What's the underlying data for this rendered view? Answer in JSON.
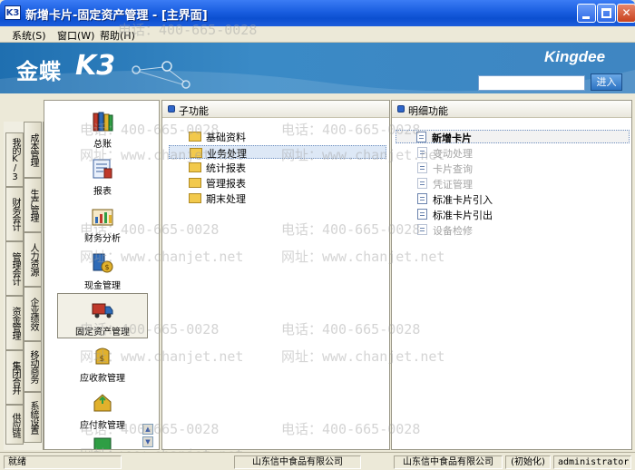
{
  "window": {
    "logo_text": "K3",
    "title": "新增卡片-固定资产管理 - [主界面]"
  },
  "menu": [
    {
      "label": "系统(S)"
    },
    {
      "label": "窗口(W)"
    },
    {
      "label": "帮助(H)"
    }
  ],
  "banner": {
    "brand_cn": "金蝶",
    "brand_k3": "K3",
    "brand_right": "Kingdee",
    "go_label": "进入",
    "search_value": ""
  },
  "left_tabs_col1": [
    {
      "label": "我的K/3"
    },
    {
      "label": "财务会计"
    },
    {
      "label": "管理会计"
    },
    {
      "label": "资金管理"
    },
    {
      "label": "集团合并"
    },
    {
      "label": "供应链"
    }
  ],
  "left_tabs_col2": [
    {
      "label": "成本管理"
    },
    {
      "label": "生产管理"
    },
    {
      "label": "人力资源"
    },
    {
      "label": "企业绩效"
    },
    {
      "label": "移动商务"
    },
    {
      "label": "系统设置"
    }
  ],
  "modules": [
    {
      "label": "总账",
      "icon": "books-icon"
    },
    {
      "label": "报表",
      "icon": "report-icon"
    },
    {
      "label": "财务分析",
      "icon": "analysis-icon"
    },
    {
      "label": "现金管理",
      "icon": "cash-icon"
    },
    {
      "label": "固定资产管理",
      "icon": "truck-icon"
    },
    {
      "label": "应收款管理",
      "icon": "receivable-icon"
    },
    {
      "label": "应付款管理",
      "icon": "payable-icon"
    }
  ],
  "sub_panel": {
    "title": "子功能",
    "items": [
      {
        "label": "基础资料"
      },
      {
        "label": "业务处理"
      },
      {
        "label": "统计报表"
      },
      {
        "label": "管理报表"
      },
      {
        "label": "期末处理"
      }
    ]
  },
  "detail_panel": {
    "title": "明细功能",
    "items": [
      {
        "label": "新增卡片"
      },
      {
        "label": "变动处理"
      },
      {
        "label": "卡片查询"
      },
      {
        "label": "凭证管理"
      },
      {
        "label": "标准卡片引入"
      },
      {
        "label": "标准卡片引出"
      },
      {
        "label": "设备检修"
      }
    ]
  },
  "watermark": {
    "phone": "电话：400-665-0028",
    "site": "网址：www.chanjet.net"
  },
  "status": {
    "ready": "就绪",
    "company1": "山东信中食品有限公司",
    "company2": "山东信中食品有限公司",
    "state": "(初始化)",
    "user": "administrator"
  },
  "colors": {
    "titlebar": "#1a5ee0",
    "banner": "#2f7fbf",
    "selection": "#dde8f6"
  }
}
